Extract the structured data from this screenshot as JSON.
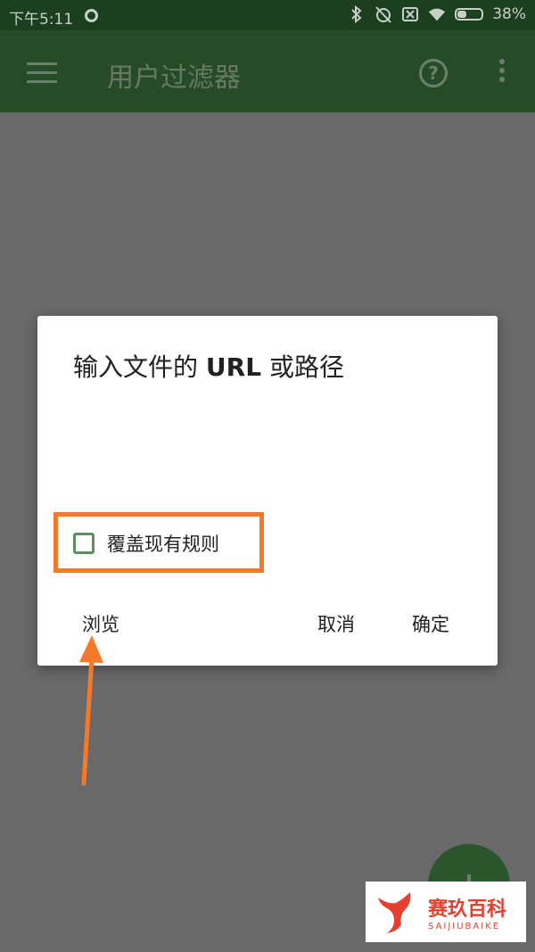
{
  "status_bar": {
    "time": "下午5:11",
    "battery": "38%",
    "battery_level": 0.38,
    "icons": [
      "ring-icon",
      "bluetooth-icon",
      "alarm-off-icon",
      "sim-off-icon",
      "wifi-icon",
      "battery-icon"
    ]
  },
  "app_bar": {
    "title": "用户过滤器",
    "icons": [
      "menu-icon",
      "help-icon",
      "more-vert-icon"
    ]
  },
  "dialog": {
    "title_prefix": "输入文件的 ",
    "title_url": "URL",
    "title_suffix": " 或路径",
    "checkbox_label": "覆盖现有规则",
    "checkbox_checked": false,
    "browse_label": "浏览",
    "cancel_label": "取消",
    "ok_label": "确定"
  },
  "colors": {
    "highlight": "#f47a2a",
    "app_bar": "#264b27",
    "watermark": "#e4402f"
  },
  "fab": {
    "icon": "plus-icon"
  },
  "watermark": {
    "cn": "赛玖百科",
    "en": "SAIJIUBAIKE"
  }
}
